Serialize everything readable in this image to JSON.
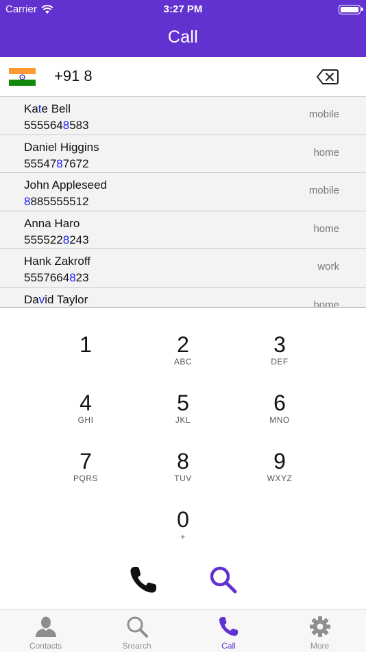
{
  "status_bar": {
    "carrier": "Carrier",
    "time": "3:27 PM"
  },
  "header": {
    "title": "Call"
  },
  "dial": {
    "number": "+91 8",
    "country_flag": "india-flag-icon"
  },
  "contacts": [
    {
      "name_pre": "Ka",
      "name_hl": "t",
      "name_post": "e Bell",
      "phone_pre": "555564",
      "phone_hl": "8",
      "phone_post": "583",
      "type": "mobile"
    },
    {
      "name_pre": "Daniel Higgins",
      "name_hl": "",
      "name_post": "",
      "phone_pre": "55547",
      "phone_hl": "8",
      "phone_post": "7672",
      "type": "home"
    },
    {
      "name_pre": "John Appleseed",
      "name_hl": "",
      "name_post": "",
      "phone_pre": "",
      "phone_hl": "8",
      "phone_post": "885555512",
      "type": "mobile"
    },
    {
      "name_pre": "Anna Haro",
      "name_hl": "",
      "name_post": "",
      "phone_pre": "555522",
      "phone_hl": "8",
      "phone_post": "243",
      "type": "home"
    },
    {
      "name_pre": "Hank Zakroff",
      "name_hl": "",
      "name_post": "",
      "phone_pre": "5557664",
      "phone_hl": "8",
      "phone_post": "23",
      "type": "work"
    },
    {
      "name_pre": "Da",
      "name_hl": "v",
      "name_post": "id Taylor",
      "phone_pre": "",
      "phone_hl": "",
      "phone_post": "",
      "type": "home"
    }
  ],
  "keypad": [
    {
      "digit": "1",
      "letters": ""
    },
    {
      "digit": "2",
      "letters": "ABC"
    },
    {
      "digit": "3",
      "letters": "DEF"
    },
    {
      "digit": "4",
      "letters": "GHI"
    },
    {
      "digit": "5",
      "letters": "JKL"
    },
    {
      "digit": "6",
      "letters": "MNO"
    },
    {
      "digit": "7",
      "letters": "PQRS"
    },
    {
      "digit": "8",
      "letters": "TUV"
    },
    {
      "digit": "9",
      "letters": "WXYZ"
    },
    {
      "digit": "0",
      "letters": "+"
    }
  ],
  "tabs": [
    {
      "label": "Contacts",
      "icon": "person-icon"
    },
    {
      "label": "Srearch",
      "icon": "search-icon"
    },
    {
      "label": "Call",
      "icon": "phone-icon"
    },
    {
      "label": "More",
      "icon": "gear-icon"
    }
  ],
  "colors": {
    "accent": "#6232d0",
    "highlight": "#1a1aff"
  }
}
